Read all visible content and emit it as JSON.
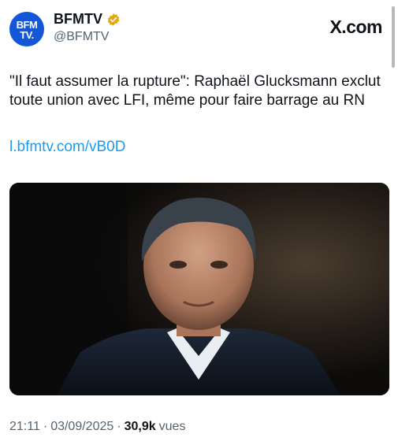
{
  "account": {
    "avatar_line1": "BFM",
    "avatar_line2": "TV.",
    "name": "BFMTV",
    "handle": "@BFMTV"
  },
  "brand": {
    "site": "X.com"
  },
  "tweet": {
    "text": "\"Il faut assumer la rupture\": Raphaël Glucksmann exclut toute union avec LFI, même pour faire barrage au RN",
    "link": "l.bfmtv.com/vB0D"
  },
  "meta": {
    "time": "21:11",
    "date": "03/09/2025",
    "views_count": "30,9k",
    "views_label": "vues"
  },
  "colors": {
    "accent": "#1d9bf0",
    "avatar_bg": "#1457d6",
    "verified": "#e8a60d"
  },
  "icons": {
    "verified": "verified-badge-icon"
  }
}
